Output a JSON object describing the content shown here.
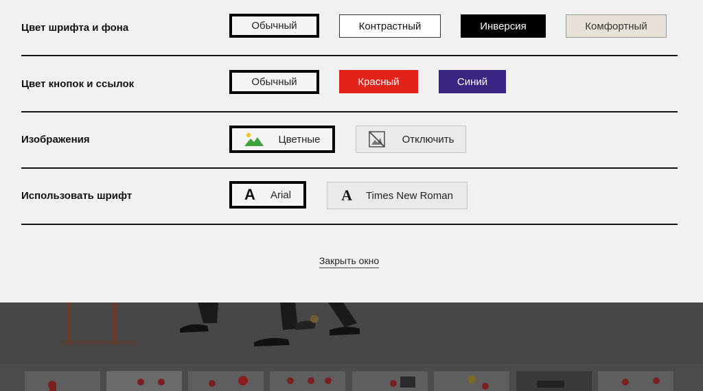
{
  "settings": {
    "font_color": {
      "label": "Цвет шрифта и фона",
      "options": [
        "Обычный",
        "Контрастный",
        "Инверсия",
        "Комфортный"
      ],
      "selected": "Обычный"
    },
    "button_color": {
      "label": "Цвет кнопок и ссылок",
      "options": [
        "Обычный",
        "Красный",
        "Синий"
      ],
      "selected": "Обычный"
    },
    "images": {
      "label": "Изображения",
      "options": [
        "Цветные",
        "Отключить"
      ],
      "icons": [
        "color-image-icon",
        "image-off-icon"
      ],
      "selected": "Цветные"
    },
    "font": {
      "label": "Использовать шрифт",
      "options": [
        "Arial",
        "Times New Roman"
      ],
      "icons": [
        "sans-letter-icon",
        "serif-letter-icon"
      ],
      "glyph": "A",
      "selected": "Arial"
    }
  },
  "close_label": "Закрыть окно",
  "colors": {
    "panel_bg": "#f1f1f1",
    "red": "#e2231a",
    "blue": "#3a2583",
    "comfort": "#e8e1d8",
    "overlay": "#3e3e3e"
  }
}
